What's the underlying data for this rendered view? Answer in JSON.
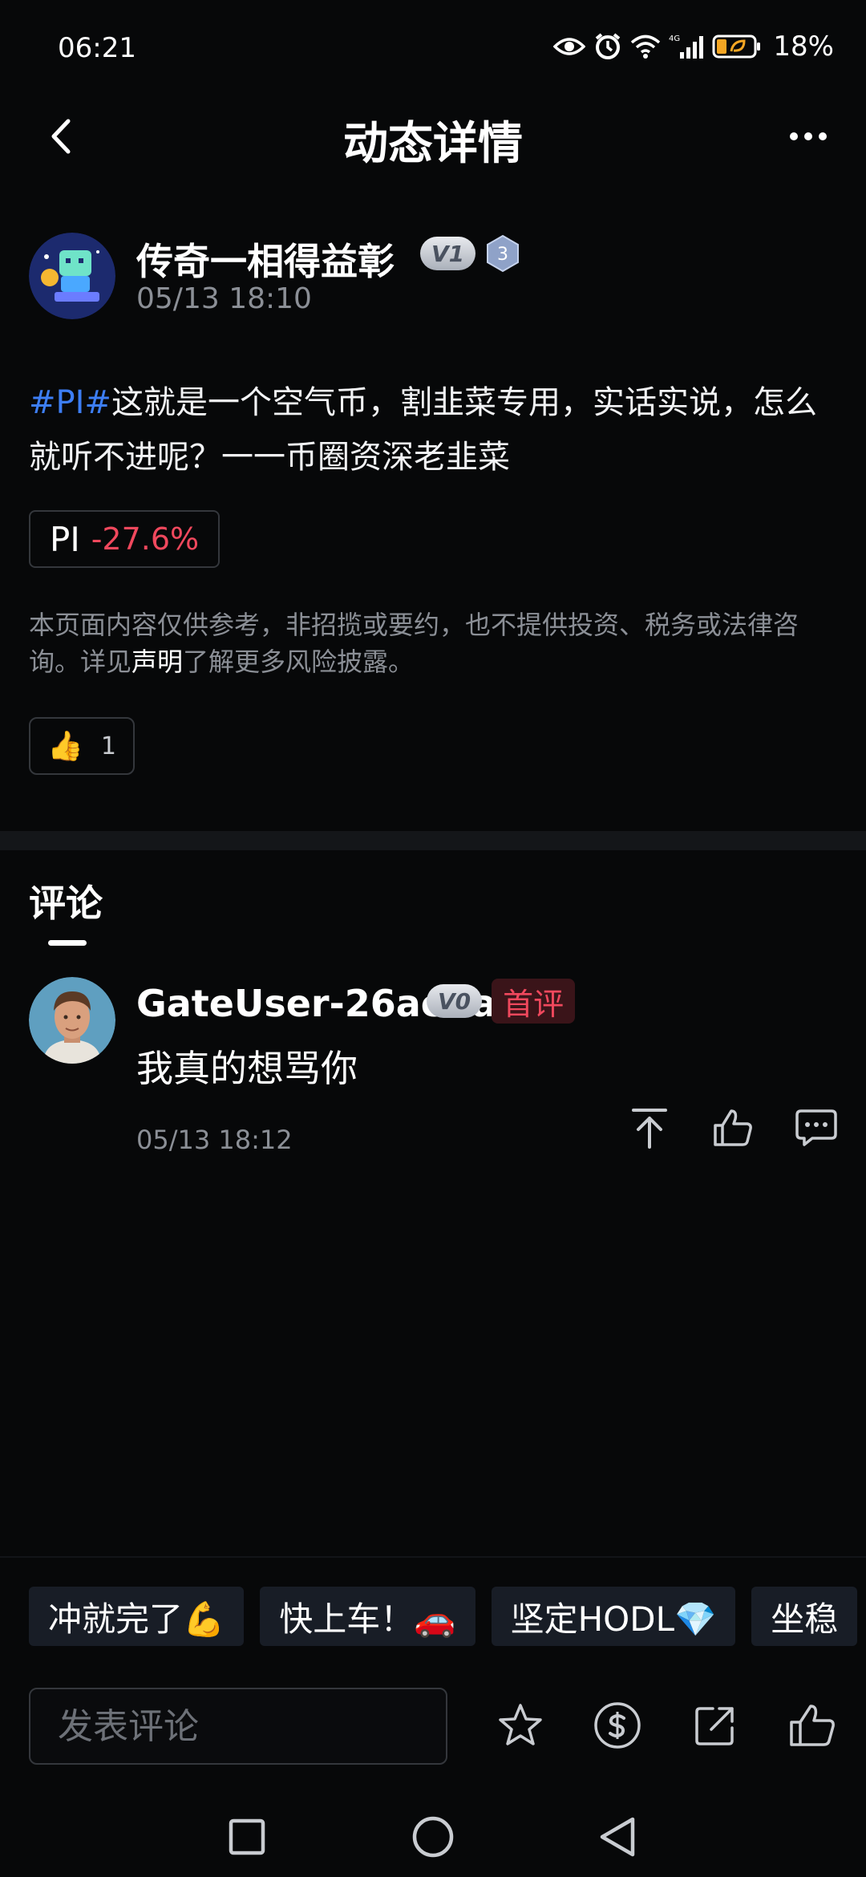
{
  "status_bar": {
    "time": "06:21",
    "battery_percent": "18%",
    "icons": [
      "eye-icon",
      "alarm-icon",
      "wifi-icon",
      "signal-4g-icon",
      "battery-saver-icon"
    ]
  },
  "header": {
    "title": "动态详情",
    "back_icon": "chevron-left-icon",
    "more_icon": "more-horizontal-icon"
  },
  "post": {
    "author": {
      "name": "传奇一相得益彰",
      "vip_badge": "V1",
      "level_badge": "3",
      "avatar_icon": "robot-avatar"
    },
    "timestamp": "05/13 18:10",
    "hashtag": "#PI#",
    "text": "这就是一个空气币，割韭菜专用，实话实说，怎么就听不进呢？一一币圈资深老韭菜",
    "ticker": {
      "symbol": "PI",
      "change": "-27.6%"
    },
    "disclaimer": {
      "before": "本页面内容仅供参考，非招揽或要约，也不提供投资、税务或法律咨询。详见",
      "link": "声明",
      "after": "了解更多风险披露。"
    },
    "reaction": {
      "emoji": "👍",
      "count": "1"
    }
  },
  "comments": {
    "title": "评论",
    "items": [
      {
        "name": "GateUser-26ae1a1c",
        "vip_badge": "V0",
        "first_badge": "首评",
        "text": "我真的想骂你",
        "time": "05/13 18:12",
        "actions": [
          "pin-top-icon",
          "thumbs-up-icon",
          "reply-icon"
        ]
      }
    ]
  },
  "quick_replies": [
    "冲就完了💪",
    "快上车！🚗",
    "坚定HODL💎",
    "坐稳"
  ],
  "bottom_bar": {
    "input_placeholder": "发表评论",
    "actions": [
      "star-icon",
      "tip-coin-icon",
      "share-icon",
      "thumbs-up-icon"
    ]
  },
  "colors": {
    "background": "#070809",
    "hashtag": "#3d7ef5",
    "negative": "#f0485d",
    "muted": "#8b8f96"
  }
}
